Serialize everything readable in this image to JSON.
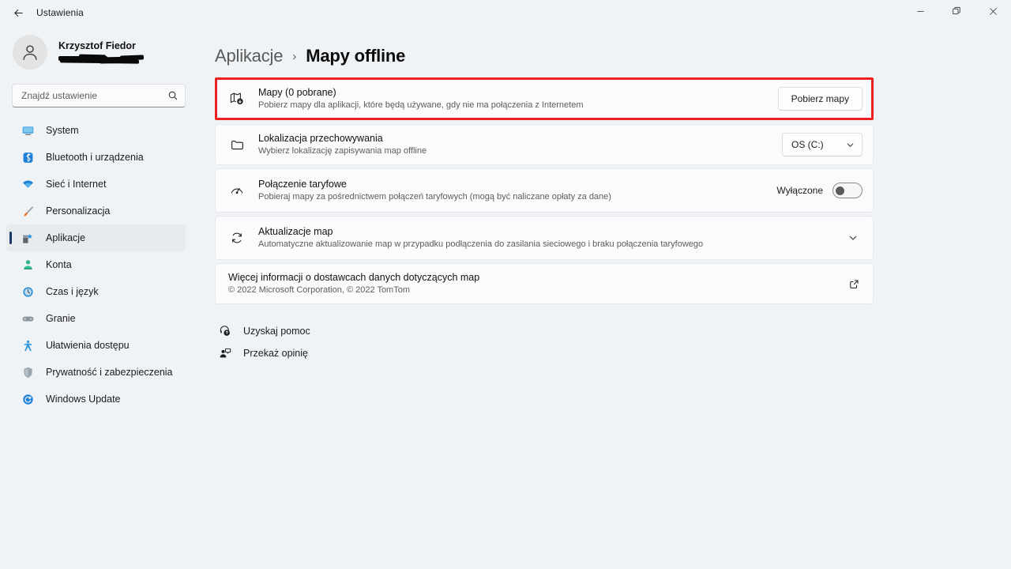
{
  "titlebar": {
    "back_icon": "arrow-left-icon",
    "title": "Ustawienia",
    "minimize_label": "─",
    "maximize_label": "❐",
    "close_label": "✕"
  },
  "account": {
    "name": "Krzysztof Fiedor",
    "email_redacted": true,
    "avatar_icon": "person-avatar-icon"
  },
  "search": {
    "placeholder": "Znajdź ustawienie",
    "value": "",
    "icon": "search-icon"
  },
  "sidebar": {
    "items": [
      {
        "label": "System",
        "icon": "monitor-icon",
        "selected": false
      },
      {
        "label": "Bluetooth i urządzenia",
        "icon": "bluetooth-icon",
        "selected": false
      },
      {
        "label": "Sieć i Internet",
        "icon": "wifi-icon",
        "selected": false
      },
      {
        "label": "Personalizacja",
        "icon": "paintbrush-icon",
        "selected": false
      },
      {
        "label": "Aplikacje",
        "icon": "apps-icon",
        "selected": true
      },
      {
        "label": "Konta",
        "icon": "account-icon",
        "selected": false
      },
      {
        "label": "Czas i język",
        "icon": "clock-globe-icon",
        "selected": false
      },
      {
        "label": "Granie",
        "icon": "gamepad-icon",
        "selected": false
      },
      {
        "label": "Ułatwienia dostępu",
        "icon": "accessibility-icon",
        "selected": false
      },
      {
        "label": "Prywatność i zabezpieczenia",
        "icon": "shield-icon",
        "selected": false
      },
      {
        "label": "Windows Update",
        "icon": "update-icon",
        "selected": false
      }
    ]
  },
  "breadcrumb": {
    "parent": "Aplikacje",
    "separator": "›",
    "current": "Mapy offline"
  },
  "highlight": {
    "color": "#ef2020"
  },
  "cards": {
    "maps": {
      "icon": "map-download-icon",
      "title": "Mapy (0 pobrane)",
      "subtitle": "Pobierz mapy dla aplikacji, które będą używane, gdy nie ma połączenia z Internetem",
      "button_label": "Pobierz mapy"
    },
    "storage": {
      "icon": "folder-icon",
      "title": "Lokalizacja przechowywania",
      "subtitle": "Wybierz lokalizację zapisywania map offline",
      "select_value": "OS (C:)",
      "chevron_icon": "chevron-down-icon"
    },
    "metered": {
      "icon": "gauge-icon",
      "title": "Połączenie taryfowe",
      "subtitle": "Pobieraj mapy za pośrednictwem połączeń taryfowych (mogą być naliczane opłaty za dane)",
      "toggle_label": "Wyłączone",
      "toggle_on": false
    },
    "updates": {
      "icon": "refresh-icon",
      "title": "Aktualizacje map",
      "subtitle": "Automatyczne aktualizowanie map w przypadku podłączenia do zasilania sieciowego i braku połączenia taryfowego",
      "chevron_icon": "chevron-down-icon"
    },
    "providers": {
      "title": "Więcej informacji o dostawcach danych dotyczących map",
      "subtitle": "© 2022 Microsoft Corporation, © 2022 TomTom",
      "external_icon": "external-link-icon"
    }
  },
  "links": [
    {
      "label": "Uzyskaj pomoc",
      "icon": "help-icon"
    },
    {
      "label": "Przekaż opinię",
      "icon": "feedback-icon"
    }
  ]
}
